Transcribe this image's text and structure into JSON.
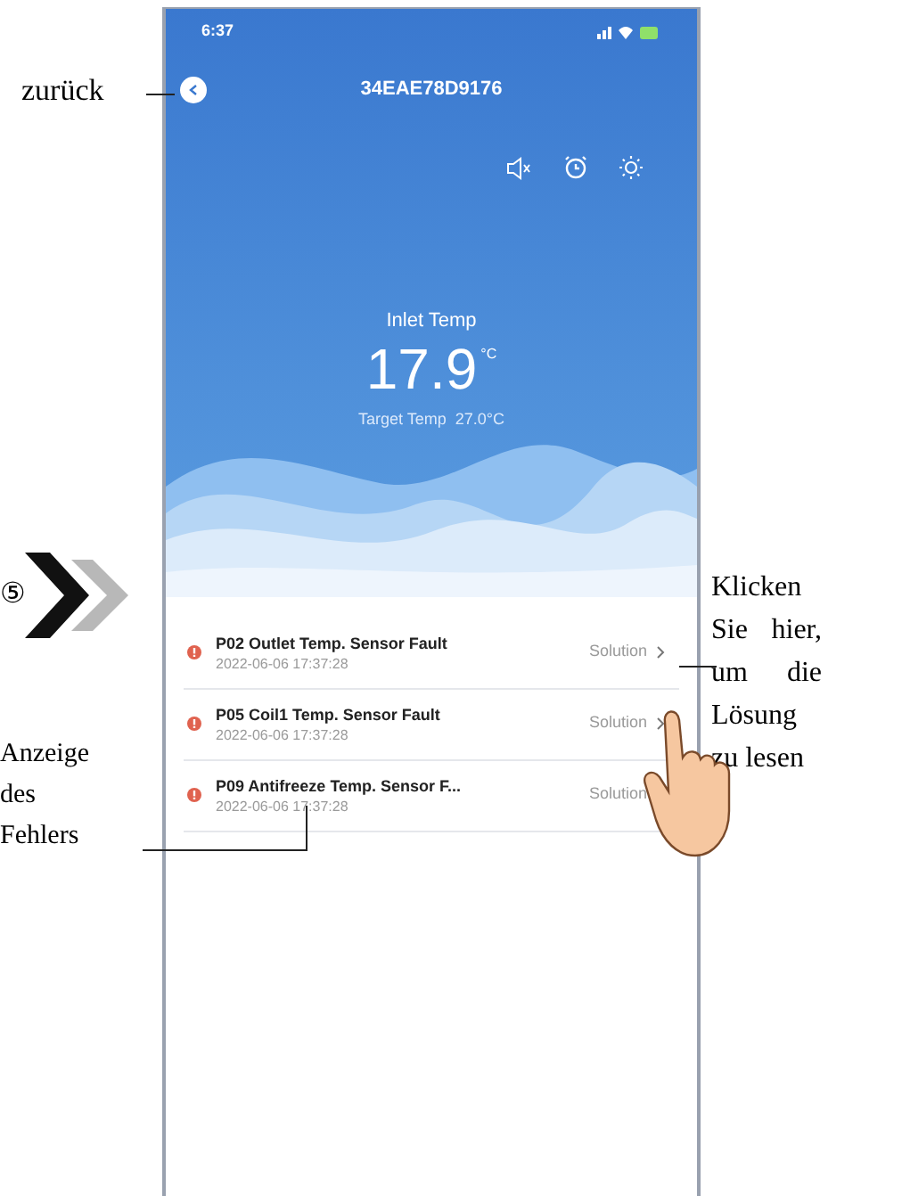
{
  "status_bar": {
    "time": "6:37"
  },
  "header": {
    "title": "34EAE78D9176"
  },
  "reading": {
    "label": "Inlet Temp",
    "value": "17.9",
    "unit": "°C",
    "target_label": "Target Temp",
    "target_value": "27.0°C"
  },
  "faults": [
    {
      "title": "P02 Outlet Temp. Sensor Fault",
      "time": "2022-06-06 17:37:28",
      "action": "Solution"
    },
    {
      "title": "P05 Coil1 Temp. Sensor Fault",
      "time": "2022-06-06 17:37:28",
      "action": "Solution"
    },
    {
      "title": "P09 Antifreeze Temp. Sensor F...",
      "time": "2022-06-06 17:37:28",
      "action": "Solution"
    }
  ],
  "annotations": {
    "back": "zurück",
    "step": "⑤",
    "error": "Anzeige des Fehlers",
    "solution": "Klicken Sie hier, um die Lösung zu lesen"
  }
}
